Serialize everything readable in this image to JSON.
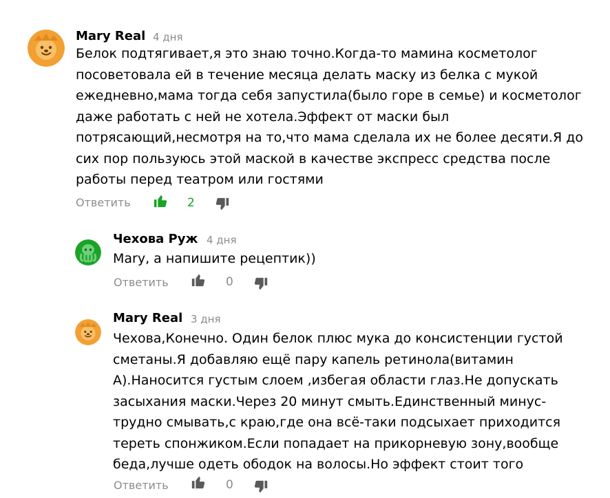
{
  "colors": {
    "author_text": "#000000",
    "meta_gray": "#8c8c8c",
    "like_active": "#1aa326",
    "icon_gray": "#5a5a5a",
    "lion_avatar": "#f2a033",
    "octopus_avatar": "#1aa326"
  },
  "comments": [
    {
      "author": "Mary Real",
      "date": "4 дня",
      "avatar_icon": "lion-avatar-icon",
      "text": "Белок подтягивает,я это знаю точно.Когда-то мамина косметолог\nпосоветовала ей в течение месяца делать маску из белка с мукой\nежедневно,мама тогда себя запустила(было горе в семье) и косметолог\nдаже работать с ней не хотела.Эффект от маски был\nпотрясающий,несмотря на то,что мама сделала их не более десяти.Я до\nсих пор пользуюсь этой маской в качестве экспресс средства после\nработы перед театром или гостями",
      "reply_label": "Ответить",
      "likes": "2",
      "liked": true
    },
    {
      "author": "Чехова Руж",
      "date": "4 дня",
      "avatar_icon": "octopus-avatar-icon",
      "text": "Mary, а напишите рецептик))",
      "reply_label": "Ответить",
      "likes": "0",
      "liked": false
    },
    {
      "author": "Mary Real",
      "date": "3 дня",
      "avatar_icon": "lion-avatar-icon",
      "text": "Чехова,Конечно. Один белок плюс мука до консистенции густой\nсметаны.Я добавляю ещё пару капель ретинола(витамин\nА).Наносится густым слоем ,избегая области глаз.Не допускать\nзасыхания маски.Через 20 минут смыть.Единственный минус-\nтрудно смывать,с краю,где она всё-таки подсыхает приходится\nтереть спонжиком.Если попадает на прикорневую зону,вообще\nбеда,лучше одеть ободок на волосы.Но эффект стоит того",
      "reply_label": "Ответить",
      "likes": "0",
      "liked": false
    }
  ]
}
